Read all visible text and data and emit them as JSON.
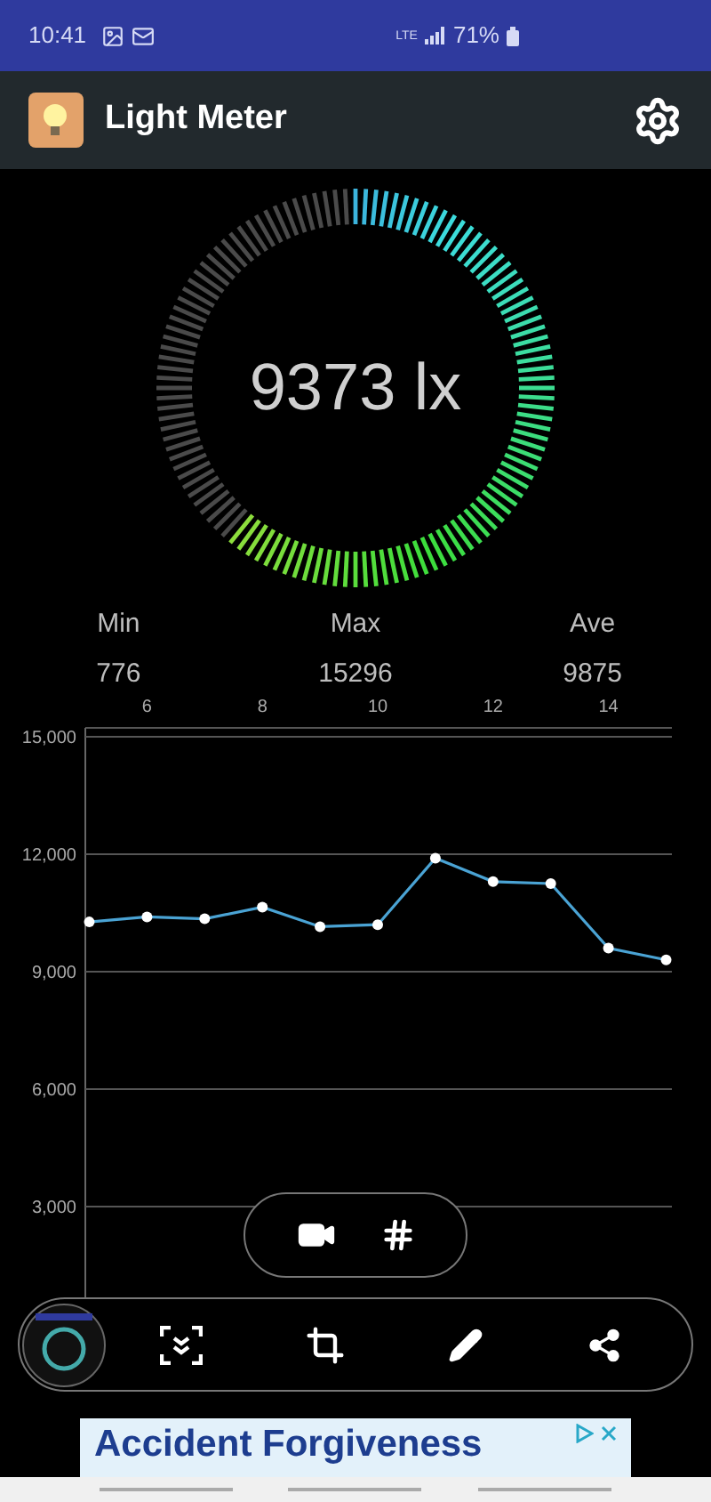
{
  "status_bar": {
    "time": "10:41",
    "network": "LTE",
    "battery": "71%"
  },
  "app_bar": {
    "title": "Light Meter"
  },
  "gauge": {
    "reading": "9373 lx"
  },
  "stats": [
    {
      "label": "Min",
      "value": "776"
    },
    {
      "label": "Max",
      "value": "15296"
    },
    {
      "label": "Ave",
      "value": "9875"
    }
  ],
  "chart": {
    "chart_data": {
      "type": "line",
      "grid": true,
      "xlim": [
        4.9,
        15.1
      ],
      "ylim": [
        0,
        15000
      ],
      "xticks": [
        6,
        8,
        10,
        12,
        14
      ],
      "yticks": [
        {
          "value": 3000,
          "label": "3,000"
        },
        {
          "value": 6000,
          "label": "6,000"
        },
        {
          "value": 9000,
          "label": "9,000"
        },
        {
          "value": 12000,
          "label": "12,000"
        },
        {
          "value": 15000,
          "label": "15,000"
        }
      ],
      "x": [
        5,
        6,
        7,
        8,
        9,
        10,
        11,
        12,
        13,
        14,
        15
      ],
      "series": [
        {
          "color": "#4aa3d4",
          "marker": "circle",
          "values": [
            10270,
            10400,
            10350,
            10650,
            10150,
            10200,
            11900,
            11300,
            11250,
            9600,
            9300
          ]
        }
      ]
    }
  },
  "ad": {
    "headline": "Accident Forgiveness"
  }
}
